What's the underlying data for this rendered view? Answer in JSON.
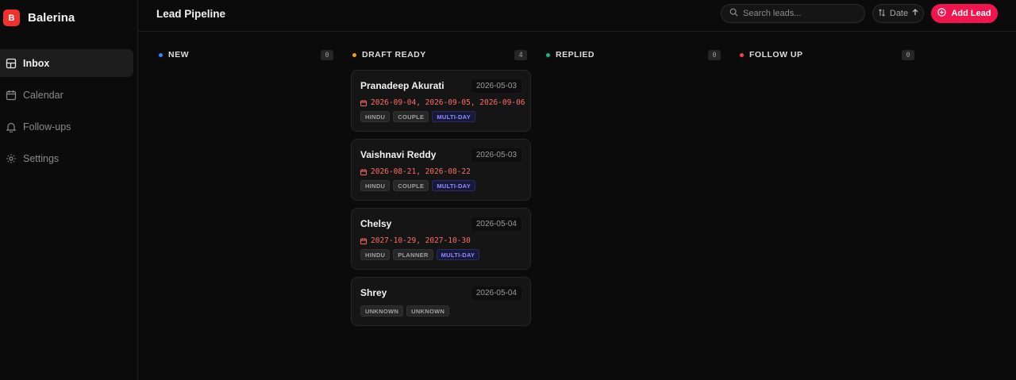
{
  "app": {
    "logo_letter": "B",
    "name": "Balerina"
  },
  "sidebar": {
    "items": [
      {
        "label": "Inbox",
        "icon": "inbox-icon",
        "active": true
      },
      {
        "label": "Calendar",
        "icon": "calendar-icon",
        "active": false
      },
      {
        "label": "Follow-ups",
        "icon": "bell-icon",
        "active": false
      },
      {
        "label": "Settings",
        "icon": "gear-icon",
        "active": false
      }
    ]
  },
  "header": {
    "title": "Lead Pipeline",
    "search_placeholder": "Search leads...",
    "sort_label": "Date",
    "add_label": "Add Lead"
  },
  "colors": {
    "accent": "#f0154d",
    "new": "#3b82f6",
    "draft_ready": "#f59e0b",
    "replied": "#10b981",
    "follow_up": "#f43f5e"
  },
  "columns": [
    {
      "title": "NEW",
      "count": "0",
      "color": "#3b82f6"
    },
    {
      "title": "DRAFT READY",
      "count": "4",
      "color": "#f59e0b"
    },
    {
      "title": "REPLIED",
      "count": "0",
      "color": "#10b981"
    },
    {
      "title": "FOLLOW UP",
      "count": "0",
      "color": "#f43f5e"
    }
  ],
  "cards": [
    {
      "name": "Pranadeep Akurati",
      "date": "2026-05-03",
      "event_dates": "2026-09-04, 2026-09-05, 2026-09-06",
      "tags": [
        "HINDU",
        "COUPLE",
        "MULTI-DAY"
      ]
    },
    {
      "name": "Vaishnavi Reddy",
      "date": "2026-05-03",
      "event_dates": "2026-08-21, 2026-08-22",
      "tags": [
        "HINDU",
        "COUPLE",
        "MULTI-DAY"
      ]
    },
    {
      "name": "Chelsy",
      "date": "2026-05-04",
      "event_dates": "2027-10-29, 2027-10-30",
      "tags": [
        "HINDU",
        "PLANNER",
        "MULTI-DAY"
      ]
    },
    {
      "name": "Shrey",
      "date": "2026-05-04",
      "event_dates": "",
      "tags": [
        "UNKNOWN",
        "UNKNOWN"
      ]
    }
  ]
}
